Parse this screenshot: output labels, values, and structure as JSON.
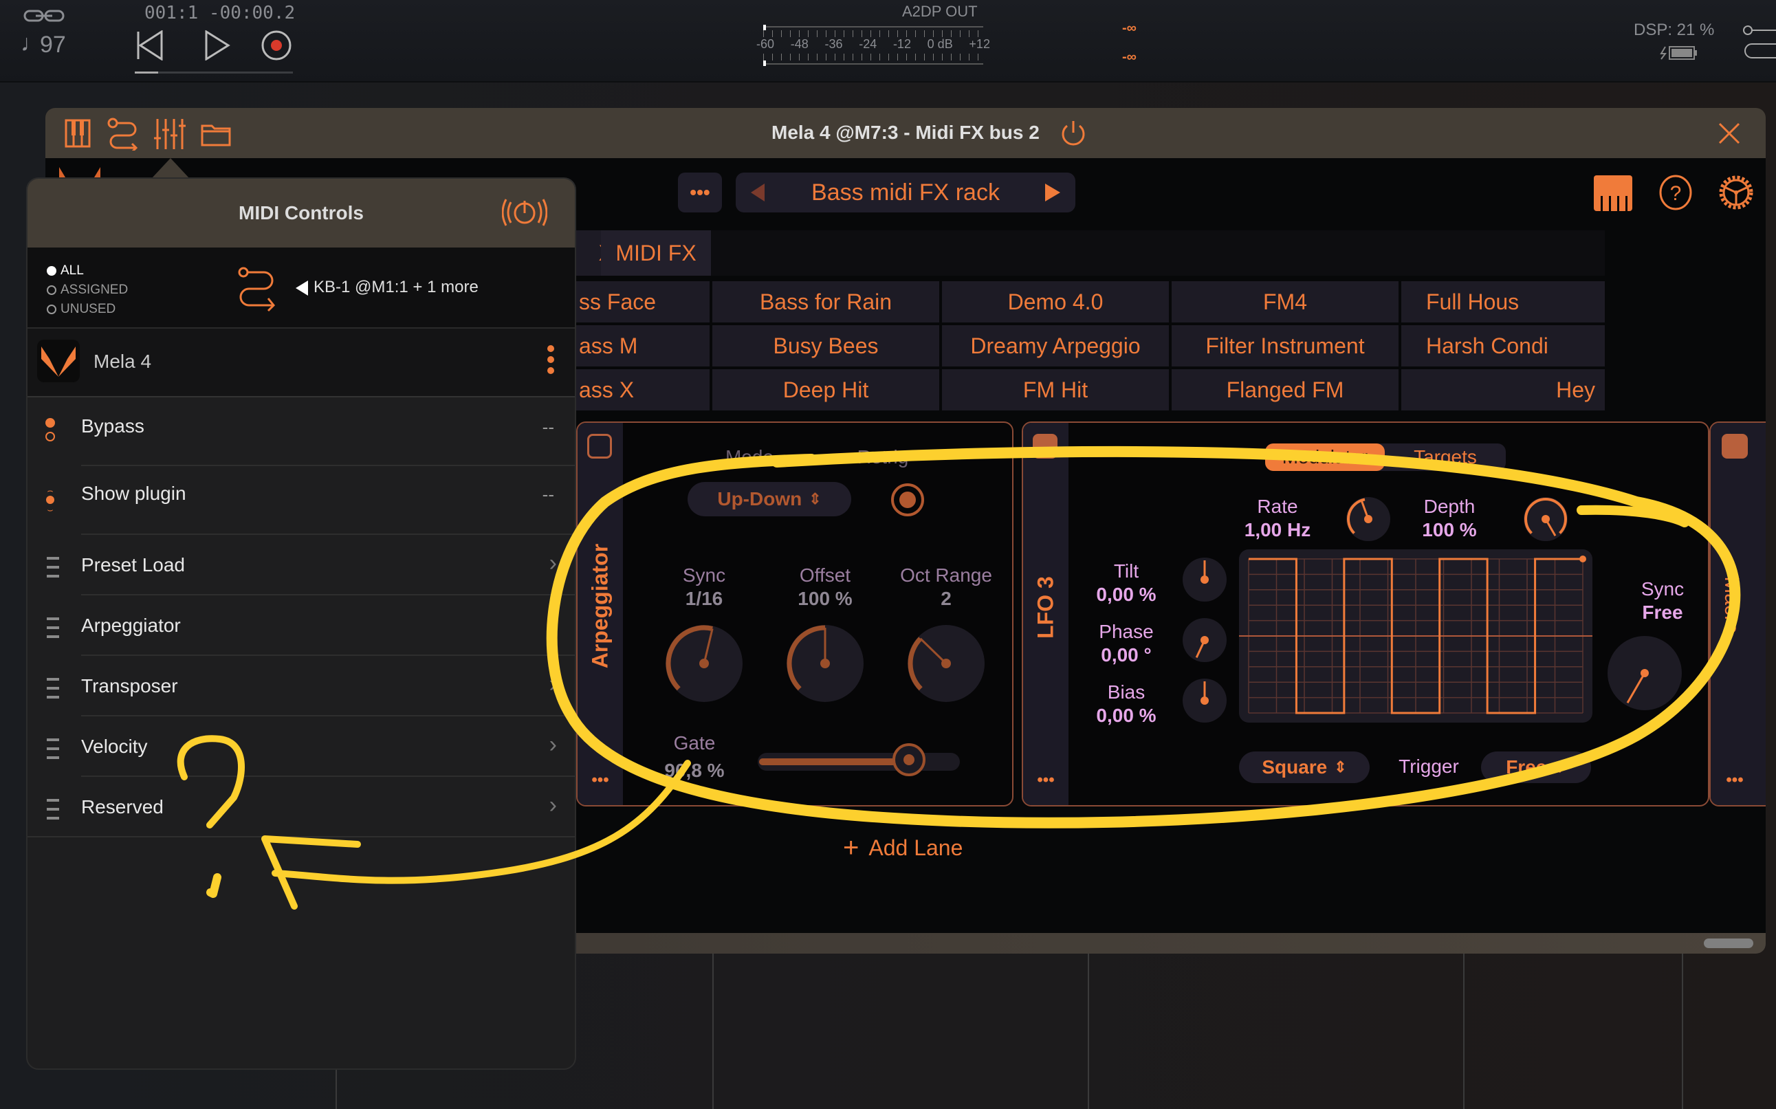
{
  "transport": {
    "link_icon": "link-icon",
    "tempo": "97",
    "position": "001:1 -00:00.2",
    "rewind_icon": "skip-back-icon",
    "play_icon": "play-icon",
    "record_icon": "record-icon",
    "record_color": "#d93a2b"
  },
  "meter": {
    "title": "A2DP OUT",
    "scale": [
      "-60",
      "-48",
      "-36",
      "-24",
      "-12",
      "0 dB",
      "+12"
    ],
    "peak_left": "-∞",
    "peak_right": "-∞"
  },
  "status": {
    "dsp": "DSP: 21 %",
    "battery_icon": "battery-charging-icon"
  },
  "window": {
    "title": "Mela 4 @M7:3 - Midi FX bus 2",
    "power_icon": "power-icon",
    "close_icon": "close-icon",
    "toolbar_icons": [
      "piano-keys-icon",
      "midi-routing-icon",
      "mixer-icon",
      "folder-icon"
    ]
  },
  "plugin": {
    "menu_label": "•••",
    "preset_name": "Bass midi FX rack",
    "prev_icon": "triangle-left-icon",
    "next_icon": "triangle-right-icon",
    "right_icons": [
      "keyboard-icon",
      "help-icon",
      "settings-gear-icon"
    ],
    "categories": [
      "X",
      "MIDI FX"
    ],
    "presets": [
      [
        "ss Face",
        "Bass for Rain",
        "Demo 4.0",
        "FM4",
        "Full Hous"
      ],
      [
        "ass M",
        "Busy Bees",
        "Dreamy Arpeggio",
        "Filter Instrument",
        "Harsh Condi"
      ],
      [
        "ass X",
        "Deep Hit",
        "FM Hit",
        "Flanged FM",
        "Hey"
      ]
    ],
    "arpeggiator": {
      "title": "Arpeggiator",
      "enabled": false,
      "mode_label": "Mode",
      "mode_value": "Up-Down",
      "retrig_label": "Retrig",
      "retrig_on": true,
      "knobs": [
        {
          "label": "Sync",
          "value": "1/16",
          "fraction": 0.55
        },
        {
          "label": "Offset",
          "value": "100 %",
          "fraction": 0.5
        },
        {
          "label": "Oct Range",
          "value": "2",
          "fraction": 0.33
        }
      ],
      "gate_label": "Gate",
      "gate_value": "90,8 %",
      "gate_fraction": 0.908,
      "more": "•••"
    },
    "lfo": {
      "title": "LFO 3",
      "enabled": true,
      "tabs": [
        "Modulator",
        "Targets"
      ],
      "active_tab": "Modulator",
      "rate_label": "Rate",
      "rate_value": "1,00 Hz",
      "depth_label": "Depth",
      "depth_value": "100 %",
      "tilt_label": "Tilt",
      "tilt_value": "0,00 %",
      "phase_label": "Phase",
      "phase_value": "0,00 °",
      "bias_label": "Bias",
      "bias_value": "0,00 %",
      "sync_label": "Sync",
      "sync_value": "Free",
      "waveform": "Square",
      "trigger_label": "Trigger",
      "trigger_value": "Free",
      "more": "•••"
    },
    "macro": {
      "title": "Macro",
      "enabled": true,
      "more": "•••"
    },
    "add_lane": "Add Lane"
  },
  "midi_controls": {
    "title": "MIDI Controls",
    "broadcast_icon": "midi-learn-icon",
    "filters": [
      {
        "label": "ALL",
        "selected": true
      },
      {
        "label": "ASSIGNED",
        "selected": false
      },
      {
        "label": "UNUSED",
        "selected": false
      }
    ],
    "source": "KB-1 @M1:1 + 1 more",
    "plugin_name": "Mela 4",
    "rows": [
      {
        "label": "Bypass",
        "icon": "toggle-icon",
        "value": "--"
      },
      {
        "label": "Show plugin",
        "icon": "momentary-icon",
        "value": "--"
      },
      {
        "label": "Preset Load",
        "icon": "list-icon",
        "chevron": true
      },
      {
        "label": "Arpeggiator",
        "icon": "list-icon",
        "chevron": true
      },
      {
        "label": "Transposer",
        "icon": "list-icon",
        "chevron": true
      },
      {
        "label": "Velocity",
        "icon": "list-icon",
        "chevron": true
      },
      {
        "label": "Reserved",
        "icon": "list-icon",
        "chevron": true
      }
    ]
  },
  "accent_color": "#f07b3a",
  "annotation_color": "#fdd02e"
}
